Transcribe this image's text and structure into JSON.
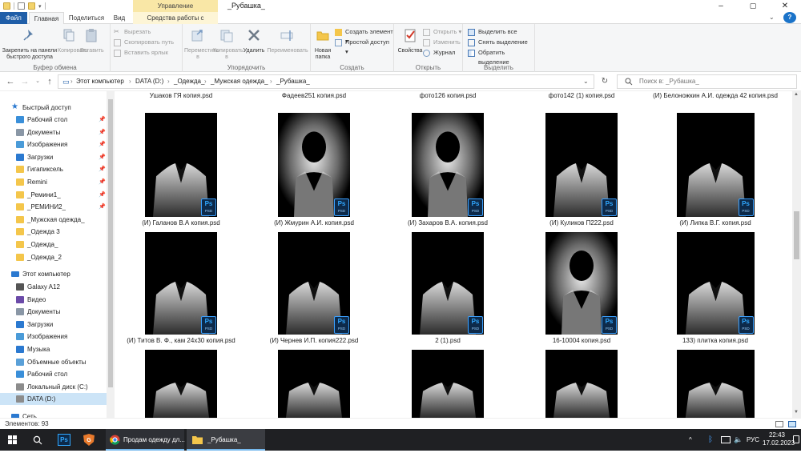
{
  "window": {
    "title": "_Рубашка_",
    "context_group": "Управление",
    "controls": {
      "minimize": "–",
      "maximize": "▢",
      "close": "✕"
    }
  },
  "ribbon_tabs": [
    {
      "label": "Файл"
    },
    {
      "label": "Главная"
    },
    {
      "label": "Поделиться"
    },
    {
      "label": "Вид"
    },
    {
      "label": "Средства работы с рисунками"
    }
  ],
  "ribbon": {
    "clipboard": {
      "label": "Буфер обмена",
      "pin": "Закрепить на панели быстрого доступа",
      "copy": "Копировать",
      "paste": "Вставить",
      "cut": "Вырезать",
      "copy_path": "Скопировать путь",
      "paste_shortcut": "Вставить ярлык"
    },
    "organize": {
      "label": "Упорядочить",
      "move_to": "Переместить в",
      "copy_to": "Копировать в",
      "delete": "Удалить",
      "rename": "Переименовать"
    },
    "create": {
      "label": "Создать",
      "new_folder": "Новая папка",
      "new_item": "Создать элемент",
      "easy_access": "Простой доступ"
    },
    "open": {
      "label": "Открыть",
      "properties": "Свойства",
      "open": "Открыть",
      "edit": "Изменить",
      "history": "Журнал"
    },
    "select": {
      "label": "Выделить",
      "select_all": "Выделить все",
      "select_none": "Снять выделение",
      "invert": "Обратить выделение"
    }
  },
  "address": {
    "crumbs": [
      "Этот компьютер",
      "DATA (D:)",
      "_Одежда_",
      "_Мужская одежда_",
      "_Рубашка_"
    ],
    "search_placeholder": "Поиск в: _Рубашка_"
  },
  "sidebar": {
    "quick_access": "Быстрый доступ",
    "quick_items": [
      {
        "label": "Рабочий стол",
        "icon": "desktop-icon",
        "pinned": true
      },
      {
        "label": "Документы",
        "icon": "documents-icon",
        "pinned": true
      },
      {
        "label": "Изображения",
        "icon": "pictures-icon",
        "pinned": true
      },
      {
        "label": "Загрузки",
        "icon": "downloads-icon",
        "pinned": true
      },
      {
        "label": "Гигапиксель",
        "icon": "folder-icon",
        "pinned": true
      },
      {
        "label": "Remini",
        "icon": "folder-icon",
        "pinned": true
      },
      {
        "label": "_Ремини1_",
        "icon": "folder-icon",
        "pinned": true
      },
      {
        "label": "_РЕМИНИ2_",
        "icon": "folder-icon",
        "pinned": true
      },
      {
        "label": "_Мужская одежда_",
        "icon": "folder-icon",
        "pinned": false
      },
      {
        "label": "_Одежда 3",
        "icon": "folder-icon",
        "pinned": false
      },
      {
        "label": "_Одежда_",
        "icon": "folder-icon",
        "pinned": false
      },
      {
        "label": "_Одежда_2",
        "icon": "folder-icon",
        "pinned": false
      }
    ],
    "this_pc": "Этот компьютер",
    "pc_items": [
      {
        "label": "Galaxy A12",
        "icon": "phone-icon"
      },
      {
        "label": "Видео",
        "icon": "videos-icon"
      },
      {
        "label": "Документы",
        "icon": "documents-icon"
      },
      {
        "label": "Загрузки",
        "icon": "downloads-icon"
      },
      {
        "label": "Изображения",
        "icon": "pictures-icon"
      },
      {
        "label": "Музыка",
        "icon": "music-icon"
      },
      {
        "label": "Объемные объекты",
        "icon": "3d-objects-icon"
      },
      {
        "label": "Рабочий стол",
        "icon": "desktop-icon"
      },
      {
        "label": "Локальный диск (C:)",
        "icon": "drive-icon"
      },
      {
        "label": "DATA (D:)",
        "icon": "drive-icon",
        "selected": true
      }
    ],
    "network": "Сеть"
  },
  "files": {
    "top_row": [
      "Ушаков ГЯ копия.psd",
      "Фадеев251 копия.psd",
      "фото126 копия.psd",
      "фото142 (1) копия.psd",
      "(И) Белоножкин А.И. одежда 42 копия.psd"
    ],
    "rows": [
      [
        "(И) Галанов В.А копия.psd",
        "(И) Жмурин А.И. копия.psd",
        "(И) Захаров В.А. копия.psd",
        "(И) Куликов П222.psd",
        "(И) Липка В.Г. копия.psd"
      ],
      [
        "(И) Титов В. Ф., кам 24x30 копия.psd",
        "(И) Чернев И.П. копия222.psd",
        "2 (1).psd",
        "16-10004 копия.psd",
        "133) плитка копия.psd"
      ]
    ],
    "ps_badge": "Ps",
    "ps_sub": "PSD"
  },
  "status": {
    "count": "Элементов: 93"
  },
  "taskbar": {
    "chrome_label": "Продам одежду дл...",
    "explorer_label": "_Рубашка_",
    "lang": "РУС",
    "time": "22:43",
    "date": "17.02.2023"
  }
}
